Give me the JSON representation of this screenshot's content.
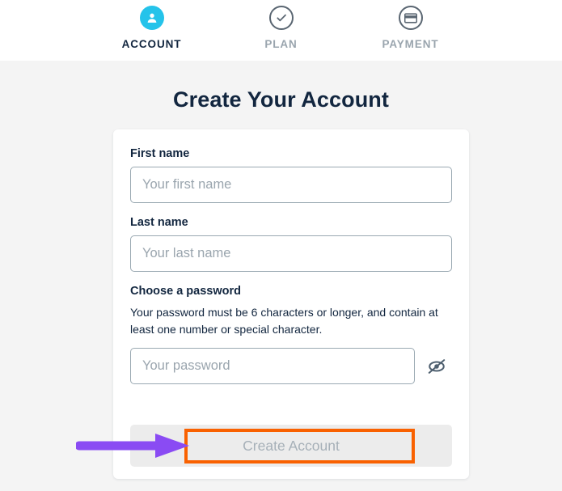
{
  "stepper": {
    "steps": [
      {
        "label": "ACCOUNT",
        "icon": "user-icon",
        "state": "active"
      },
      {
        "label": "PLAN",
        "icon": "check-circle-icon",
        "state": "inactive"
      },
      {
        "label": "PAYMENT",
        "icon": "credit-card-icon",
        "state": "inactive"
      }
    ]
  },
  "page": {
    "title": "Create Your Account"
  },
  "form": {
    "first_name": {
      "label": "First name",
      "placeholder": "Your first name",
      "value": ""
    },
    "last_name": {
      "label": "Last name",
      "placeholder": "Your last name",
      "value": ""
    },
    "password": {
      "label": "Choose a password",
      "help": "Your password must be 6 characters or longer, and contain at least one number or special character.",
      "placeholder": "Your password",
      "value": "",
      "toggle_icon": "eye-slash-icon"
    },
    "submit": {
      "label": "Create Account",
      "disabled": true
    }
  },
  "colors": {
    "accent_cyan": "#25c3ea",
    "heading_navy": "#12263f",
    "muted_gray": "#9aa5ae",
    "input_border": "#9aa9b2",
    "button_bg": "#ececec",
    "button_text": "#a6b0b8",
    "annotation_orange": "#f96100",
    "annotation_purple": "#8a4bf3",
    "page_bg": "#f4f4f4"
  }
}
